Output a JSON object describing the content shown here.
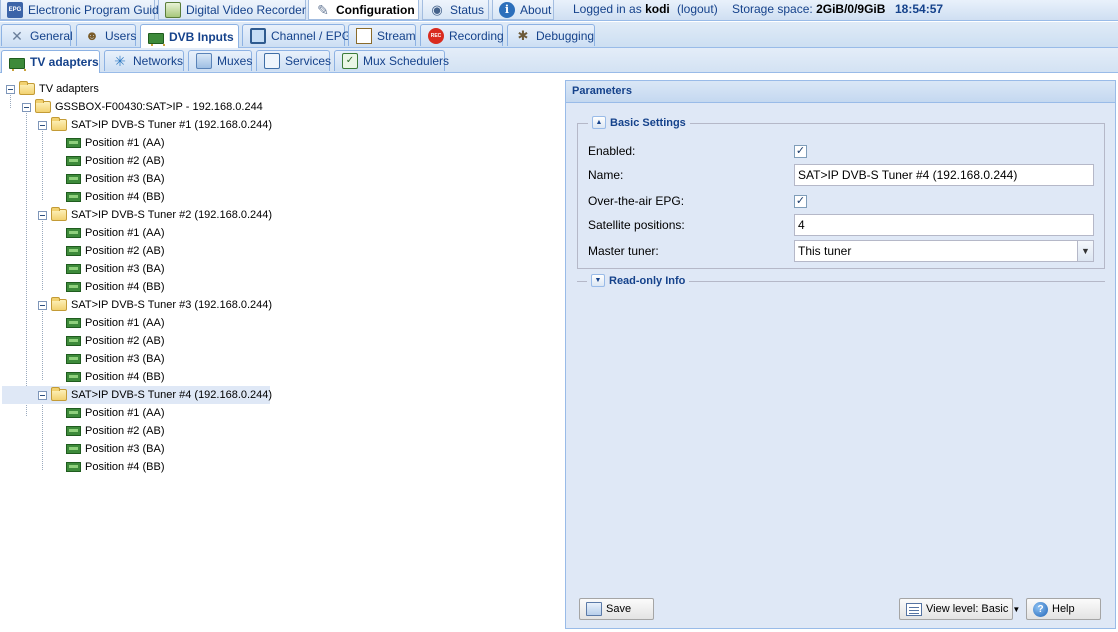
{
  "topbar": {
    "tabs": [
      {
        "label": "Electronic Program Guide",
        "icon": "epg-icon"
      },
      {
        "label": "Digital Video Recorder",
        "icon": "dvr-icon"
      },
      {
        "label": "Configuration",
        "icon": "configuration-icon",
        "active": true
      },
      {
        "label": "Status",
        "icon": "eye-icon"
      },
      {
        "label": "About",
        "icon": "info-icon"
      }
    ],
    "logged_in_prefix": "Logged in as",
    "user": "kodi",
    "logout": "(logout)",
    "storage_prefix": "Storage space:",
    "storage_value": "2GiB/0/9GiB",
    "clock": "18:54:57"
  },
  "config_tabs": [
    {
      "label": "General",
      "icon": "wrench-icon"
    },
    {
      "label": "Users",
      "icon": "users-icon"
    },
    {
      "label": "DVB Inputs",
      "icon": "tuner-card-icon",
      "active": true
    },
    {
      "label": "Channel / EPG",
      "icon": "tv-icon"
    },
    {
      "label": "Stream",
      "icon": "stream-icon"
    },
    {
      "label": "Recording",
      "icon": "rec-icon"
    },
    {
      "label": "Debugging",
      "icon": "bug-icon"
    }
  ],
  "dvb_tabs": [
    {
      "label": "TV adapters",
      "icon": "tuner-card-icon",
      "active": true
    },
    {
      "label": "Networks",
      "icon": "network-icon"
    },
    {
      "label": "Muxes",
      "icon": "mux-icon"
    },
    {
      "label": "Services",
      "icon": "services-icon"
    },
    {
      "label": "Mux Schedulers",
      "icon": "scheduler-icon"
    }
  ],
  "tree": {
    "root": "TV adapters",
    "server": "GSSBOX-F00430:SAT>IP - 192.168.0.244",
    "tuners": [
      {
        "label": "SAT>IP DVB-S Tuner #1 (192.168.0.244)",
        "positions": [
          "Position #1 (AA)",
          "Position #2 (AB)",
          "Position #3 (BA)",
          "Position #4 (BB)"
        ]
      },
      {
        "label": "SAT>IP DVB-S Tuner #2 (192.168.0.244)",
        "positions": [
          "Position #1 (AA)",
          "Position #2 (AB)",
          "Position #3 (BA)",
          "Position #4 (BB)"
        ]
      },
      {
        "label": "SAT>IP DVB-S Tuner #3 (192.168.0.244)",
        "positions": [
          "Position #1 (AA)",
          "Position #2 (AB)",
          "Position #3 (BA)",
          "Position #4 (BB)"
        ]
      },
      {
        "label": "SAT>IP DVB-S Tuner #4 (192.168.0.244)",
        "positions": [
          "Position #1 (AA)",
          "Position #2 (AB)",
          "Position #3 (BA)",
          "Position #4 (BB)"
        ],
        "selected": true
      }
    ]
  },
  "params": {
    "title": "Parameters",
    "basic_legend": "Basic Settings",
    "enabled_label": "Enabled:",
    "enabled_checked": true,
    "name_label": "Name:",
    "name_value": "SAT>IP DVB-S Tuner #4 (192.168.0.244)",
    "epg_label": "Over-the-air EPG:",
    "epg_checked": true,
    "sat_label": "Satellite positions:",
    "sat_value": "4",
    "master_label": "Master tuner:",
    "master_value": "This tuner",
    "readonly_legend": "Read-only Info",
    "save_label": "Save",
    "view_level_label": "View level: Basic",
    "help_label": "Help"
  },
  "colors": {
    "accent_text": "#15428b",
    "panel_bg": "#dfe8f6",
    "border": "#99bbe8",
    "selected_row": "#dfe8f6"
  }
}
